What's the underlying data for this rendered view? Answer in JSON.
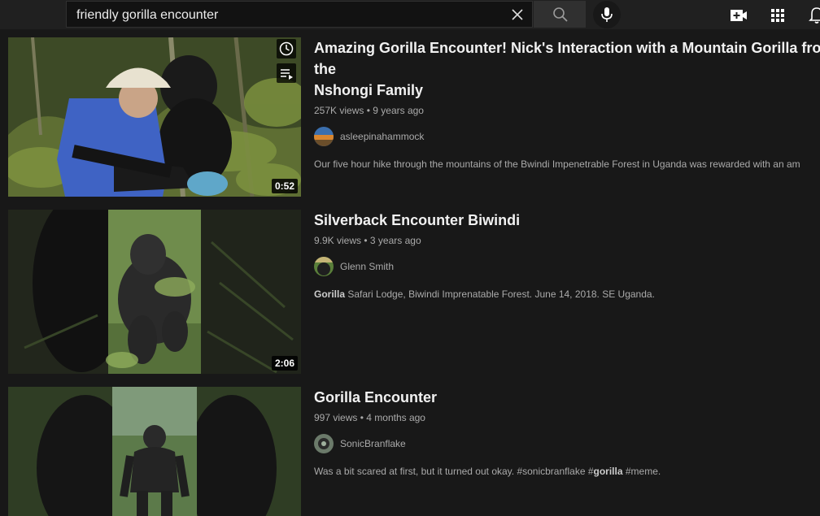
{
  "search": {
    "query": "friendly gorilla encounter"
  },
  "results": [
    {
      "title_line1": "Amazing Gorilla Encounter! Nick's Interaction with a Mountain Gorilla from the",
      "title_line2": "Nshongi Family",
      "views": "257K views",
      "age": "9 years ago",
      "channel": "asleepinahammock",
      "description": "Our five hour hike through the mountains of the Bwindi Impenetrable Forest in Uganda was rewarded with an am",
      "duration": "0:52"
    },
    {
      "title_line1": "Silverback Encounter Biwindi",
      "views": "9.9K views",
      "age": "3 years ago",
      "channel": "Glenn Smith",
      "description_bold": "Gorilla",
      "description": " Safari Lodge, Biwindi Imprenatable Forest. June 14, 2018. SE Uganda.",
      "duration": "2:06"
    },
    {
      "title_line1": "Gorilla Encounter",
      "views": "997 views",
      "age": "4 months ago",
      "channel": "SonicBranflake",
      "description_a": "Was a bit scared at first, but it turned out okay. #sonicbranflake #",
      "description_bold": "gorilla",
      "description_b": " #meme."
    }
  ],
  "meta_separator": "•",
  "icons": {
    "clear": "close-icon",
    "search": "search-icon",
    "mic": "microphone-icon",
    "create": "video-add-icon",
    "apps": "apps-grid-icon",
    "notifications": "bell-icon",
    "watch_later": "clock-icon",
    "add_to_queue": "queue-icon"
  }
}
